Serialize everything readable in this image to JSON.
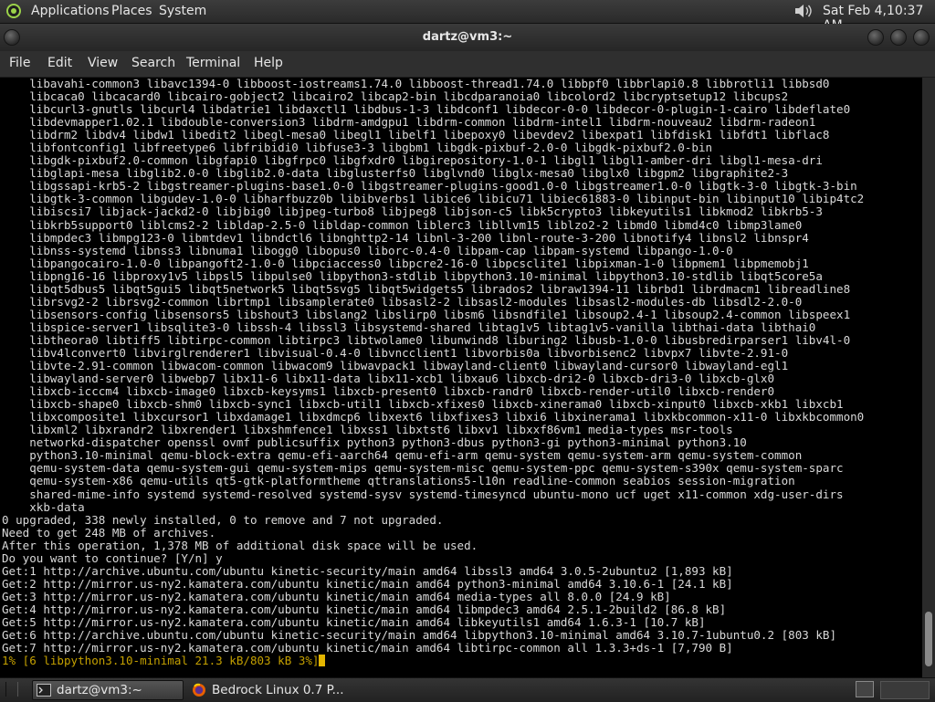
{
  "top_panel": {
    "menus": [
      "Applications",
      "Places",
      "System"
    ],
    "clock": "Sat Feb  4,10:37 AM"
  },
  "window": {
    "title": "dartz@vm3:~",
    "menubar": [
      "File",
      "Edit",
      "View",
      "Search",
      "Terminal",
      "Help"
    ]
  },
  "terminal": {
    "lines": [
      "    libavahi-common3 libavc1394-0 libboost-iostreams1.74.0 libboost-thread1.74.0 libbpf0 libbrlapi0.8 libbrotli1 libbsd0",
      "    libcaca0 libcacard0 libcairo-gobject2 libcairo2 libcap2-bin libcdparanoia0 libcolord2 libcryptsetup12 libcups2",
      "    libcurl3-gnutls libcurl4 libdatrie1 libdaxctl1 libdbus-1-3 libdconf1 libdecor-0-0 libdecor-0-plugin-1-cairo libdeflate0",
      "    libdevmapper1.02.1 libdouble-conversion3 libdrm-amdgpu1 libdrm-common libdrm-intel1 libdrm-nouveau2 libdrm-radeon1",
      "    libdrm2 libdv4 libdw1 libedit2 libegl-mesa0 libegl1 libelf1 libepoxy0 libevdev2 libexpat1 libfdisk1 libfdt1 libflac8",
      "    libfontconfig1 libfreetype6 libfribidi0 libfuse3-3 libgbm1 libgdk-pixbuf-2.0-0 libgdk-pixbuf2.0-bin",
      "    libgdk-pixbuf2.0-common libgfapi0 libgfrpc0 libgfxdr0 libgirepository-1.0-1 libgl1 libgl1-amber-dri libgl1-mesa-dri",
      "    libglapi-mesa libglib2.0-0 libglib2.0-data libglusterfs0 libglvnd0 libglx-mesa0 libglx0 libgpm2 libgraphite2-3",
      "    libgssapi-krb5-2 libgstreamer-plugins-base1.0-0 libgstreamer-plugins-good1.0-0 libgstreamer1.0-0 libgtk-3-0 libgtk-3-bin",
      "    libgtk-3-common libgudev-1.0-0 libharfbuzz0b libibverbs1 libice6 libicu71 libiec61883-0 libinput-bin libinput10 libip4tc2",
      "    libiscsi7 libjack-jackd2-0 libjbig0 libjpeg-turbo8 libjpeg8 libjson-c5 libk5crypto3 libkeyutils1 libkmod2 libkrb5-3",
      "    libkrb5support0 liblcms2-2 libldap-2.5-0 libldap-common liblerc3 libllvm15 liblzo2-2 libmd0 libmd4c0 libmp3lame0",
      "    libmpdec3 libmpg123-0 libmtdev1 libndctl6 libnghttp2-14 libnl-3-200 libnl-route-3-200 libnotify4 libnsl2 libnspr4",
      "    libnss-systemd libnss3 libnuma1 libogg0 libopus0 liborc-0.4-0 libpam-cap libpam-systemd libpango-1.0-0",
      "    libpangocairo-1.0-0 libpangoft2-1.0-0 libpciaccess0 libpcre2-16-0 libpcsclite1 libpixman-1-0 libpmem1 libpmemobj1",
      "    libpng16-16 libproxy1v5 libpsl5 libpulse0 libpython3-stdlib libpython3.10-minimal libpython3.10-stdlib libqt5core5a",
      "    libqt5dbus5 libqt5gui5 libqt5network5 libqt5svg5 libqt5widgets5 librados2 libraw1394-11 librbd1 librdmacm1 libreadline8",
      "    librsvg2-2 librsvg2-common librtmp1 libsamplerate0 libsasl2-2 libsasl2-modules libsasl2-modules-db libsdl2-2.0-0",
      "    libsensors-config libsensors5 libshout3 libslang2 libslirp0 libsm6 libsndfile1 libsoup2.4-1 libsoup2.4-common libspeex1",
      "    libspice-server1 libsqlite3-0 libssh-4 libssl3 libsystemd-shared libtag1v5 libtag1v5-vanilla libthai-data libthai0",
      "    libtheora0 libtiff5 libtirpc-common libtirpc3 libtwolame0 libunwind8 liburing2 libusb-1.0-0 libusbredirparser1 libv4l-0",
      "    libv4lconvert0 libvirglrenderer1 libvisual-0.4-0 libvncclient1 libvorbis0a libvorbisenc2 libvpx7 libvte-2.91-0",
      "    libvte-2.91-common libwacom-common libwacom9 libwavpack1 libwayland-client0 libwayland-cursor0 libwayland-egl1",
      "    libwayland-server0 libwebp7 libx11-6 libx11-data libx11-xcb1 libxau6 libxcb-dri2-0 libxcb-dri3-0 libxcb-glx0",
      "    libxcb-icccm4 libxcb-image0 libxcb-keysyms1 libxcb-present0 libxcb-randr0 libxcb-render-util0 libxcb-render0",
      "    libxcb-shape0 libxcb-shm0 libxcb-sync1 libxcb-util1 libxcb-xfixes0 libxcb-xinerama0 libxcb-xinput0 libxcb-xkb1 libxcb1",
      "    libxcomposite1 libxcursor1 libxdamage1 libxdmcp6 libxext6 libxfixes3 libxi6 libxinerama1 libxkbcommon-x11-0 libxkbcommon0",
      "    libxml2 libxrandr2 libxrender1 libxshmfence1 libxss1 libxtst6 libxv1 libxxf86vm1 media-types msr-tools",
      "    networkd-dispatcher openssl ovmf publicsuffix python3 python3-dbus python3-gi python3-minimal python3.10",
      "    python3.10-minimal qemu-block-extra qemu-efi-aarch64 qemu-efi-arm qemu-system qemu-system-arm qemu-system-common",
      "    qemu-system-data qemu-system-gui qemu-system-mips qemu-system-misc qemu-system-ppc qemu-system-s390x qemu-system-sparc",
      "    qemu-system-x86 qemu-utils qt5-gtk-platformtheme qttranslations5-l10n readline-common seabios session-migration",
      "    shared-mime-info systemd systemd-resolved systemd-sysv systemd-timesyncd ubuntu-mono ucf uget x11-common xdg-user-dirs",
      "    xkb-data",
      "0 upgraded, 338 newly installed, 0 to remove and 7 not upgraded.",
      "Need to get 248 MB of archives.",
      "After this operation, 1,378 MB of additional disk space will be used.",
      "Do you want to continue? [Y/n] y",
      "Get:1 http://archive.ubuntu.com/ubuntu kinetic-security/main amd64 libssl3 amd64 3.0.5-2ubuntu2 [1,893 kB]",
      "Get:2 http://mirror.us-ny2.kamatera.com/ubuntu kinetic/main amd64 python3-minimal amd64 3.10.6-1 [24.1 kB]",
      "Get:3 http://mirror.us-ny2.kamatera.com/ubuntu kinetic/main amd64 media-types all 8.0.0 [24.9 kB]",
      "Get:4 http://mirror.us-ny2.kamatera.com/ubuntu kinetic/main amd64 libmpdec3 amd64 2.5.1-2build2 [86.8 kB]",
      "Get:5 http://mirror.us-ny2.kamatera.com/ubuntu kinetic/main amd64 libkeyutils1 amd64 1.6.3-1 [10.7 kB]",
      "Get:6 http://archive.ubuntu.com/ubuntu kinetic-security/main amd64 libpython3.10-minimal amd64 3.10.7-1ubuntu0.2 [803 kB]",
      "Get:7 http://mirror.us-ny2.kamatera.com/ubuntu kinetic/main amd64 libtirpc-common all 1.3.3+ds-1 [7,790 B]"
    ],
    "progress": "1% [6 libpython3.10-minimal 21.3 kB/803 kB 3%]"
  },
  "taskbar": {
    "tasks": [
      {
        "label": "dartz@vm3:~",
        "icon": "terminal-icon",
        "active": true
      },
      {
        "label": "Bedrock Linux 0.7 P...",
        "icon": "firefox-icon",
        "active": false
      }
    ]
  },
  "colors": {
    "terminal_bg": "#000000",
    "terminal_fg": "#d9d9d9",
    "progress_fg": "#c4a000",
    "cursor": "#e3b500",
    "distro_accent": "#9bd24a"
  }
}
